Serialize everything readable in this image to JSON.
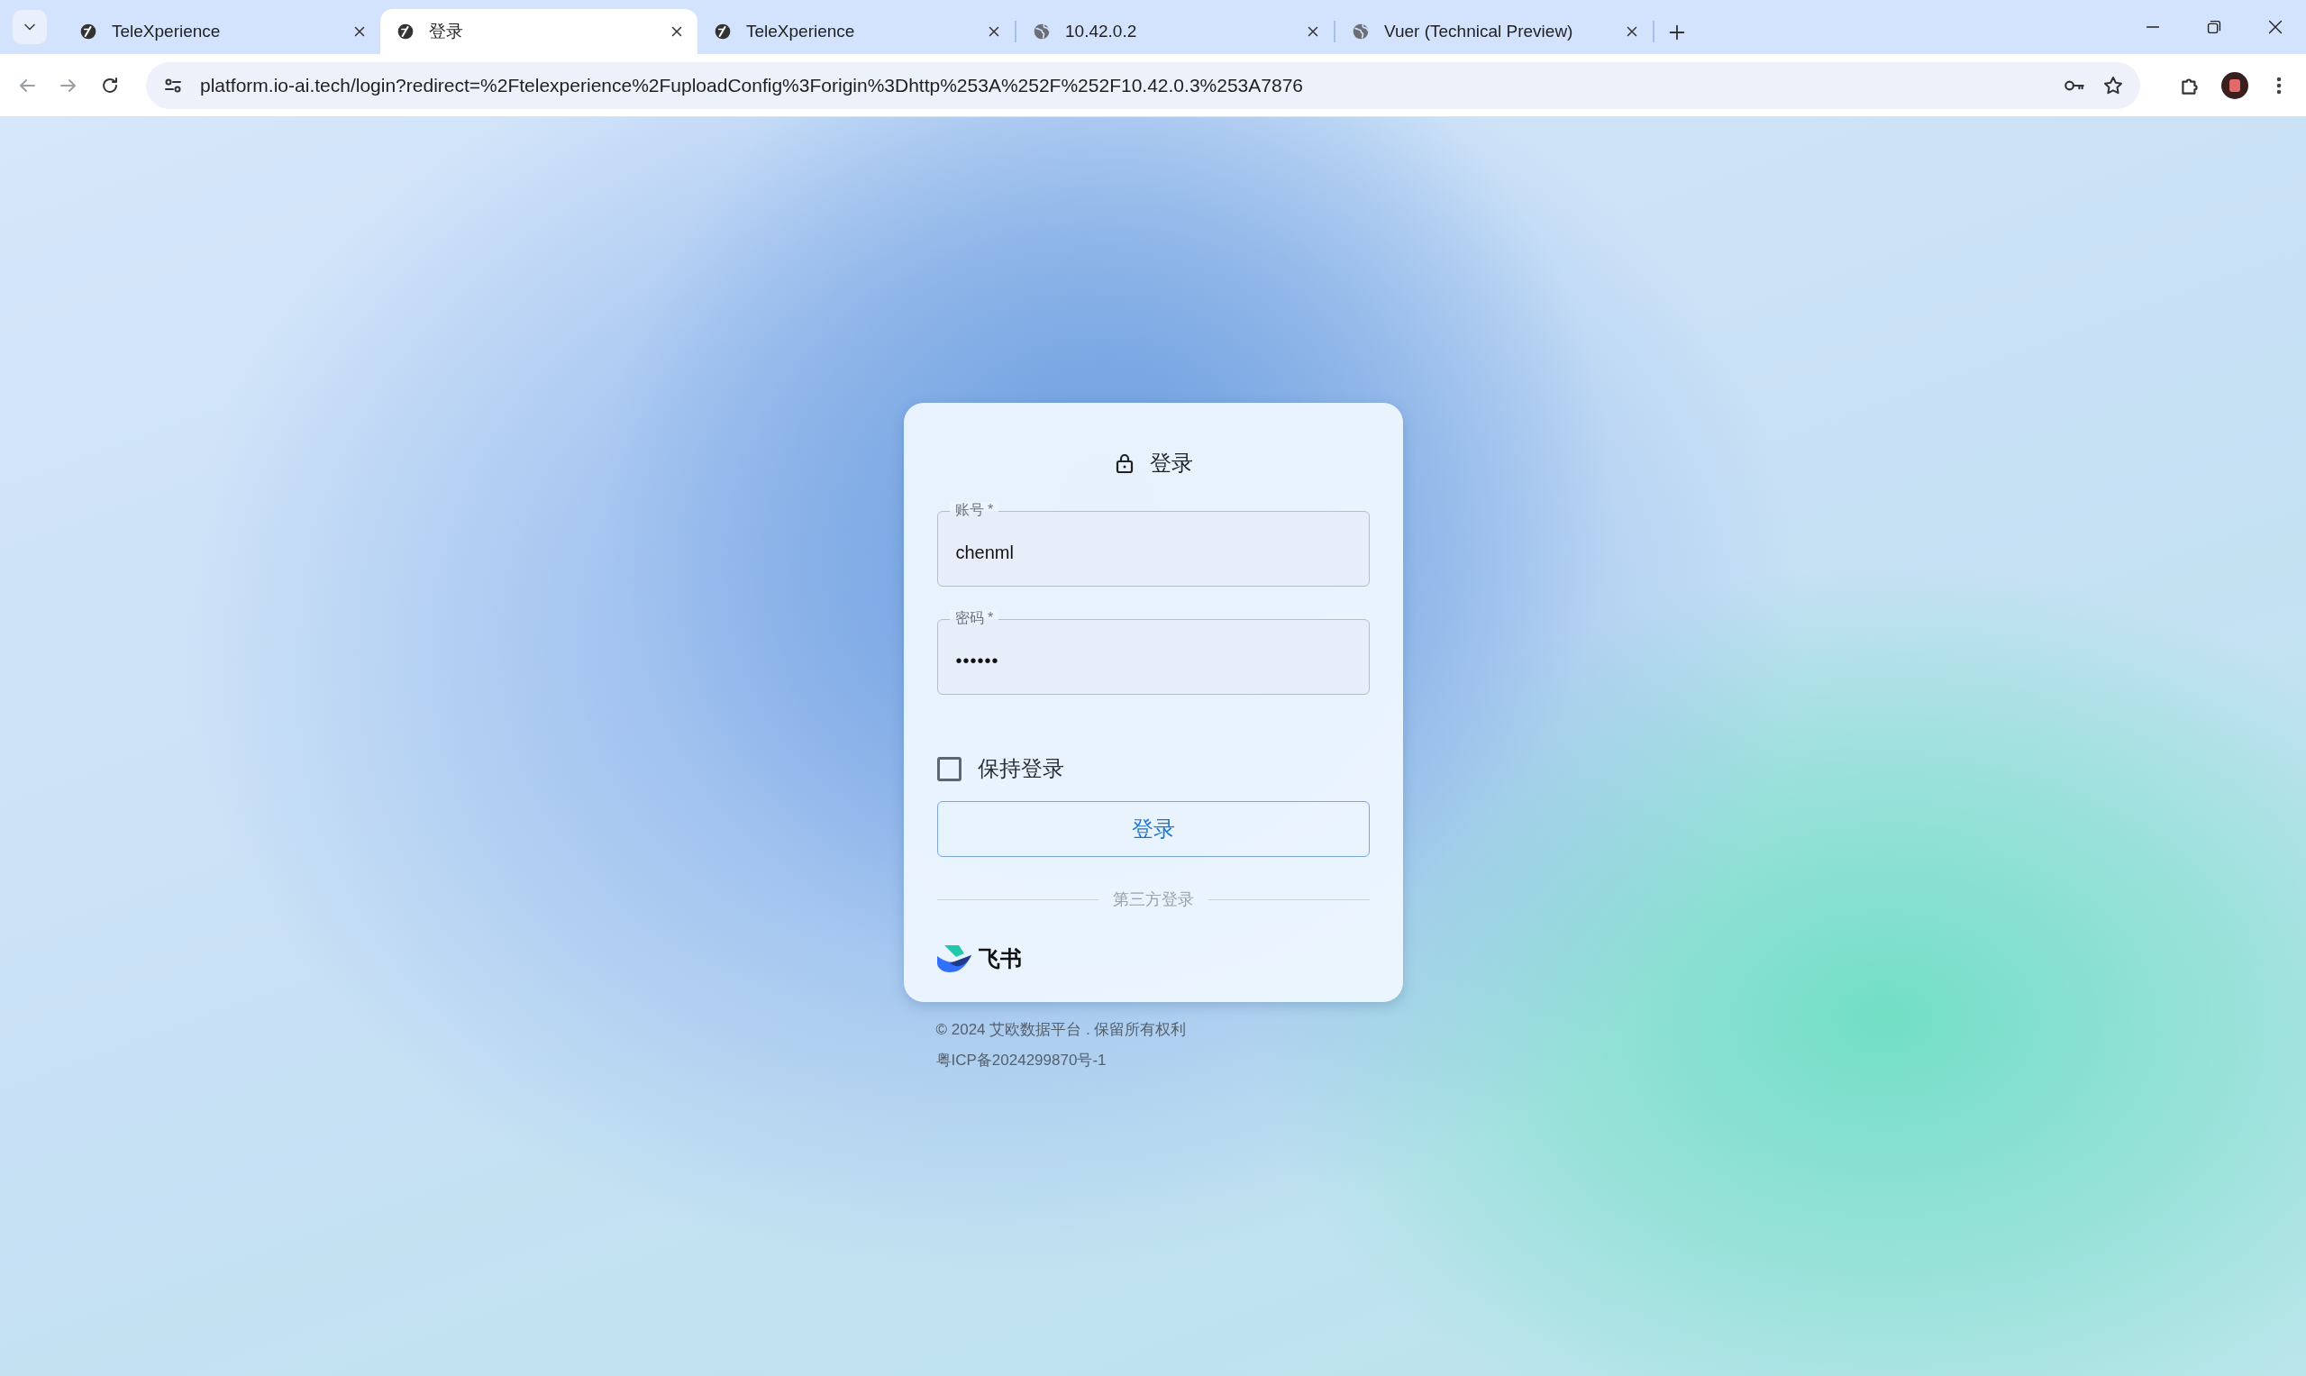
{
  "browser": {
    "tabs": [
      {
        "title": "TeleXperience",
        "kind": "app",
        "selected": false
      },
      {
        "title": "登录",
        "kind": "app",
        "selected": true
      },
      {
        "title": "TeleXperience",
        "kind": "app",
        "selected": false
      },
      {
        "title": "10.42.0.2",
        "kind": "web",
        "selected": false
      },
      {
        "title": "Vuer (Technical Preview)",
        "kind": "web",
        "selected": false
      }
    ],
    "address": "platform.io-ai.tech/login?redirect=%2Ftelexperience%2FuploadConfig%3Forigin%3Dhttp%253A%252F%252F10.42.0.3%253A7876"
  },
  "login": {
    "title": "登录",
    "fields": [
      {
        "label": "账号 *",
        "value": "chenml",
        "kind": "text"
      },
      {
        "label": "密码 *",
        "value": "••••••",
        "kind": "password"
      }
    ],
    "remember": {
      "label": "保持登录",
      "checked": false
    },
    "button": "登录",
    "divider": "第三方登录",
    "providers": [
      {
        "label": "飞书"
      }
    ]
  },
  "footer": [
    "© 2024 艾欧数据平台 . 保留所有权利",
    "粤ICP备2024299870号-1"
  ]
}
